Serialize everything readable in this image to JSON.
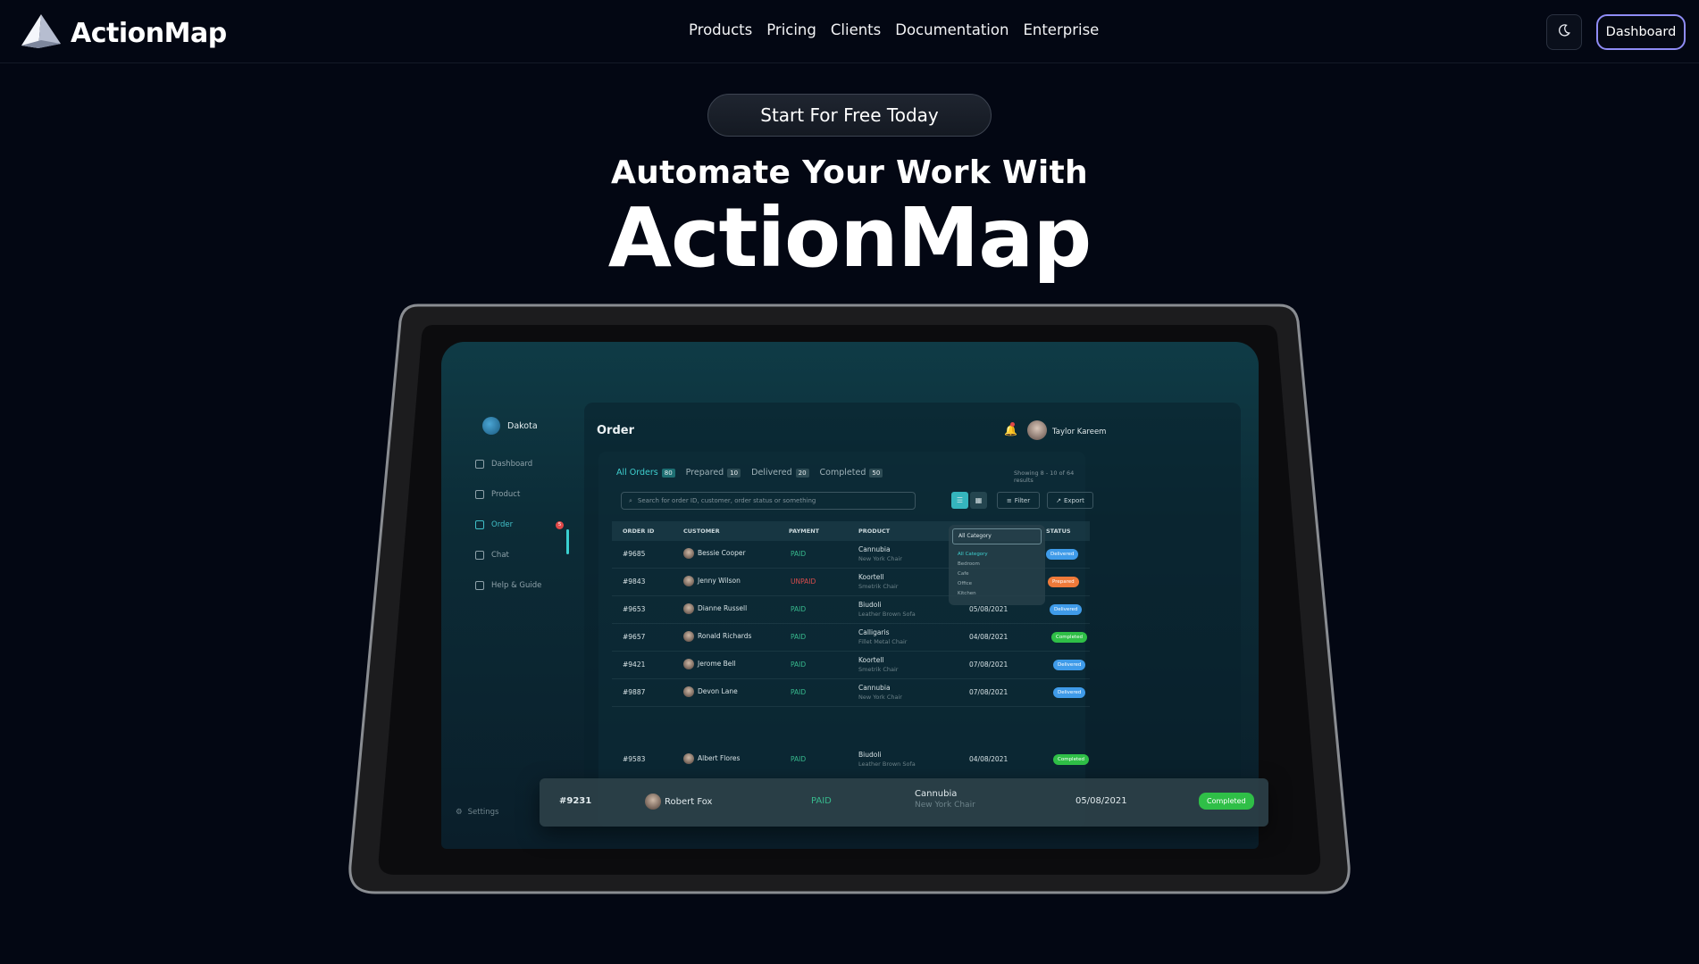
{
  "header": {
    "brand": "ActionMap",
    "nav": [
      "Products",
      "Pricing",
      "Clients",
      "Documentation",
      "Enterprise"
    ],
    "theme_icon": "moon-icon",
    "dashboard_label": "Dashboard"
  },
  "hero": {
    "cta_label": "Start For Free Today",
    "subtitle": "Automate Your Work With",
    "title": "ActionMap"
  },
  "app": {
    "workspace": "Dakota",
    "sidebar": {
      "items": [
        {
          "label": "Dashboard",
          "icon": "home-icon"
        },
        {
          "label": "Product",
          "icon": "box-icon"
        },
        {
          "label": "Order",
          "icon": "order-icon",
          "badge": "5"
        },
        {
          "label": "Chat",
          "icon": "chat-icon"
        },
        {
          "label": "Help & Guide",
          "icon": "help-icon"
        }
      ],
      "settings": "Settings"
    },
    "page_title": "Order",
    "user_name": "Taylor Kareem",
    "tabs": [
      {
        "label": "All Orders",
        "count": "80"
      },
      {
        "label": "Prepared",
        "count": "10"
      },
      {
        "label": "Delivered",
        "count": "20"
      },
      {
        "label": "Completed",
        "count": "50"
      }
    ],
    "showing": "Showing 8 - 10 of 64 results",
    "search_placeholder": "Search for order ID, customer, order status or something",
    "filter_label": "Filter",
    "export_label": "Export",
    "columns": [
      "ORDER ID",
      "CUSTOMER",
      "PAYMENT",
      "PRODUCT",
      "STATUS"
    ],
    "category": {
      "selected": "All Category",
      "options": [
        "All Category",
        "Bedroom",
        "Cafe",
        "Office",
        "Kitchen"
      ]
    },
    "rows": [
      {
        "id": "#9685",
        "customer": "Bessie Cooper",
        "payment": "PAID",
        "product": "Cannubia",
        "product_sub": "New York Chair",
        "date": "",
        "status": "Delivered"
      },
      {
        "id": "#9843",
        "customer": "Jenny Wilson",
        "payment": "UNPAID",
        "product": "Koortell",
        "product_sub": "Smetrik Chair",
        "date": "",
        "status": "Prepared"
      },
      {
        "id": "#9653",
        "customer": "Dianne Russell",
        "payment": "PAID",
        "product": "Biudoli",
        "product_sub": "Leather Brown Sofa",
        "date": "05/08/2021",
        "status": "Delivered"
      },
      {
        "id": "#9657",
        "customer": "Ronald Richards",
        "payment": "PAID",
        "product": "Calligaris",
        "product_sub": "Fillet Metal Chair",
        "date": "04/08/2021",
        "status": "Completed"
      },
      {
        "id": "#9421",
        "customer": "Jerome Bell",
        "payment": "PAID",
        "product": "Koortell",
        "product_sub": "Smetrik Chair",
        "date": "07/08/2021",
        "status": "Delivered"
      },
      {
        "id": "#9887",
        "customer": "Devon Lane",
        "payment": "PAID",
        "product": "Cannubia",
        "product_sub": "New York Chair",
        "date": "07/08/2021",
        "status": "Delivered"
      }
    ],
    "focus_row": {
      "id": "#9231",
      "customer": "Robert Fox",
      "payment": "PAID",
      "product": "Cannubia",
      "product_sub": "New York Chair",
      "date": "05/08/2021",
      "status": "Completed"
    },
    "last_row": {
      "id": "#9583",
      "customer": "Albert Flores",
      "payment": "PAID",
      "product": "Biudoli",
      "product_sub": "Leather Brown Sofa",
      "date": "04/08/2021",
      "status": "Completed"
    }
  },
  "colors": {
    "background": "#030713",
    "accent": "#8f8cf5",
    "teal": "#3fcfcf",
    "delivered": "#3f9be9",
    "prepared": "#ee7a3a",
    "completed": "#2fbf47"
  }
}
